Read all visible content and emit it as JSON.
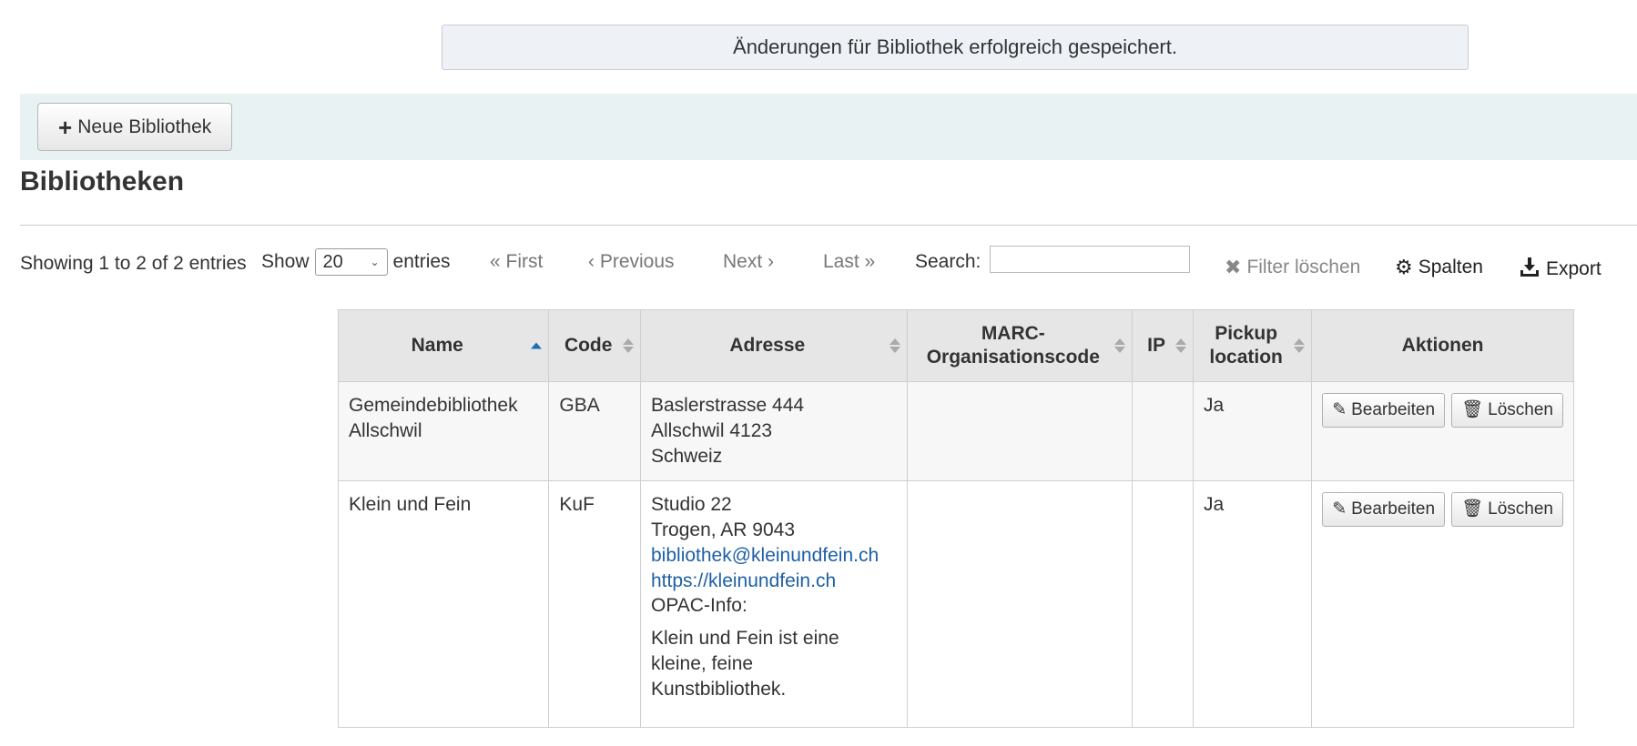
{
  "alert": {
    "message": "Änderungen für Bibliothek erfolgreich gespeichert."
  },
  "toolbar": {
    "new_library_icon": "plus-icon",
    "new_library_label": "Neue Bibliothek"
  },
  "page": {
    "title": "Bibliotheken"
  },
  "datatable": {
    "info": "Showing 1 to 2 of 2 entries",
    "show_label": "Show",
    "page_length": "20",
    "entries_label": "entries",
    "pager": {
      "first": "« First",
      "previous": "‹ Previous",
      "next": "Next ›",
      "last": "Last »"
    },
    "search_label": "Search:",
    "search_value": "",
    "clear_filter": "Filter löschen",
    "columns": "Spalten",
    "export": "Export"
  },
  "table": {
    "headers": {
      "name": "Name",
      "code": "Code",
      "address": "Adresse",
      "marc_line1": "MARC-",
      "marc_line2": "Organisationscode",
      "ip": "IP",
      "pickup_line1": "Pickup",
      "pickup_line2": "location",
      "actions": "Aktionen"
    },
    "sort": {
      "column": "Name",
      "direction": "ascending"
    },
    "rows": [
      {
        "name_line1": "Gemeindebibliothek",
        "name_line2": "Allschwil",
        "code": "GBA",
        "address": [
          "Baslerstrasse 444",
          "Allschwil 4123",
          "Schweiz"
        ],
        "marc": "",
        "ip": "",
        "pickup": "Ja",
        "edit": "Bearbeiten",
        "delete": "Löschen"
      },
      {
        "name": "Klein und Fein",
        "code": "KuF",
        "address": [
          "Studio 22",
          "Trogen, AR 9043"
        ],
        "email": "bibliothek@kleinundfein.ch",
        "url": "https://kleinundfein.ch",
        "opac_label": "OPAC-Info:",
        "opac_text": [
          "Klein und Fein ist eine",
          "kleine, feine",
          "Kunstbibliothek."
        ],
        "marc": "",
        "ip": "",
        "pickup": "Ja",
        "edit": "Bearbeiten",
        "delete": "Löschen"
      }
    ]
  },
  "colors": {
    "link": "#1d5fa5",
    "header_bg": "#e6e6e6",
    "toolbar_bg": "#e9f2f3",
    "alert_bg": "#eef2f7"
  }
}
